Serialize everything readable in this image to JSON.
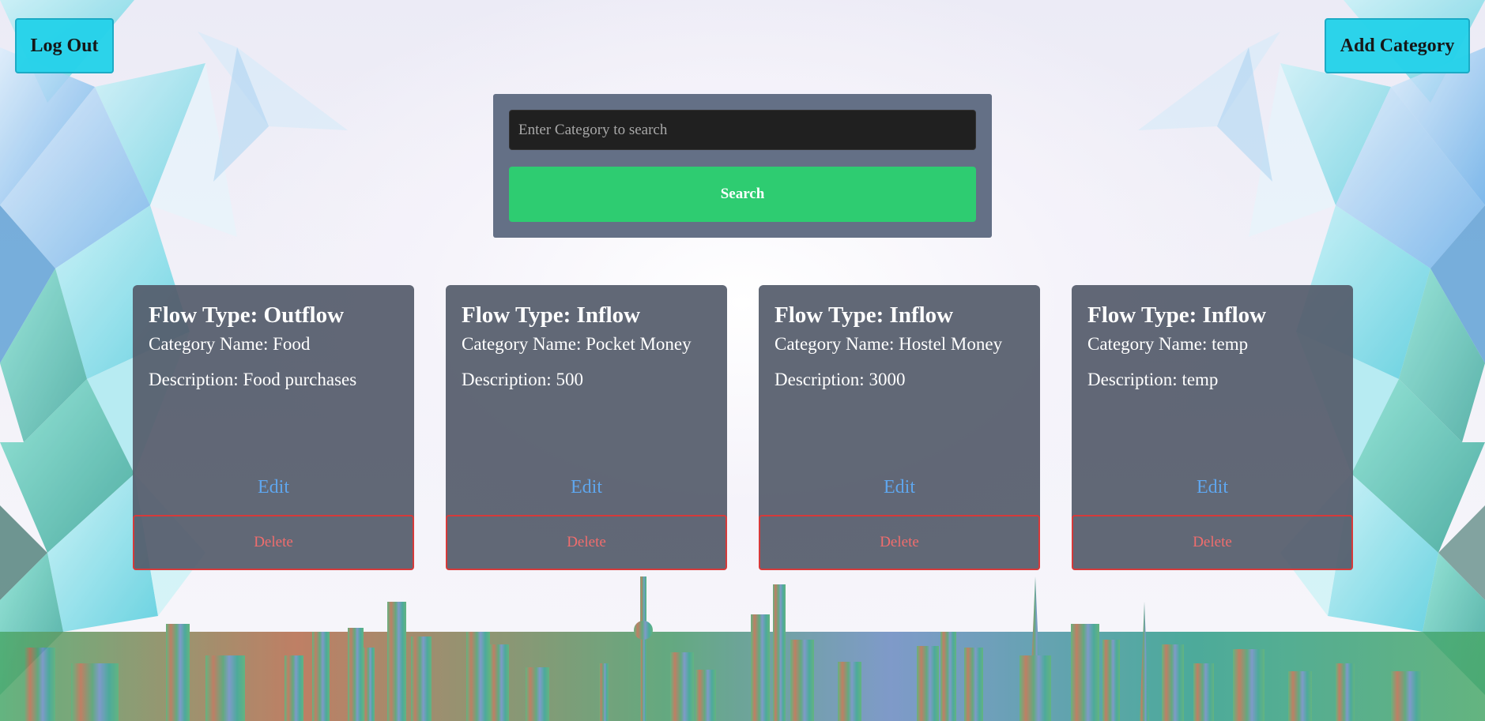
{
  "header": {
    "logout_label": "Log Out",
    "add_category_label": "Add Category"
  },
  "search": {
    "placeholder": "Enter Category to search",
    "value": "",
    "button_label": "Search"
  },
  "cards": [
    {
      "flow_type": "Flow Type: Outflow",
      "category_name": "Category Name: Food",
      "description": "Description: Food purchases",
      "edit_label": "Edit",
      "delete_label": "Delete"
    },
    {
      "flow_type": "Flow Type: Inflow",
      "category_name": "Category Name: Pocket Money",
      "description": "Description: 500",
      "edit_label": "Edit",
      "delete_label": "Delete"
    },
    {
      "flow_type": "Flow Type: Inflow",
      "category_name": "Category Name: Hostel Money",
      "description": "Description: 3000",
      "edit_label": "Edit",
      "delete_label": "Delete"
    },
    {
      "flow_type": "Flow Type: Inflow",
      "category_name": "Category Name: temp",
      "description": "Description: temp",
      "edit_label": "Edit",
      "delete_label": "Delete"
    }
  ],
  "colors": {
    "top_button": "#26d2ea",
    "search_button": "#2ecc71",
    "card_background": "#545b6a",
    "edit_link": "#5fa6ee",
    "delete_border": "#d63a3a"
  },
  "background": {
    "image": "low-poly crystal shards with city skyline"
  }
}
